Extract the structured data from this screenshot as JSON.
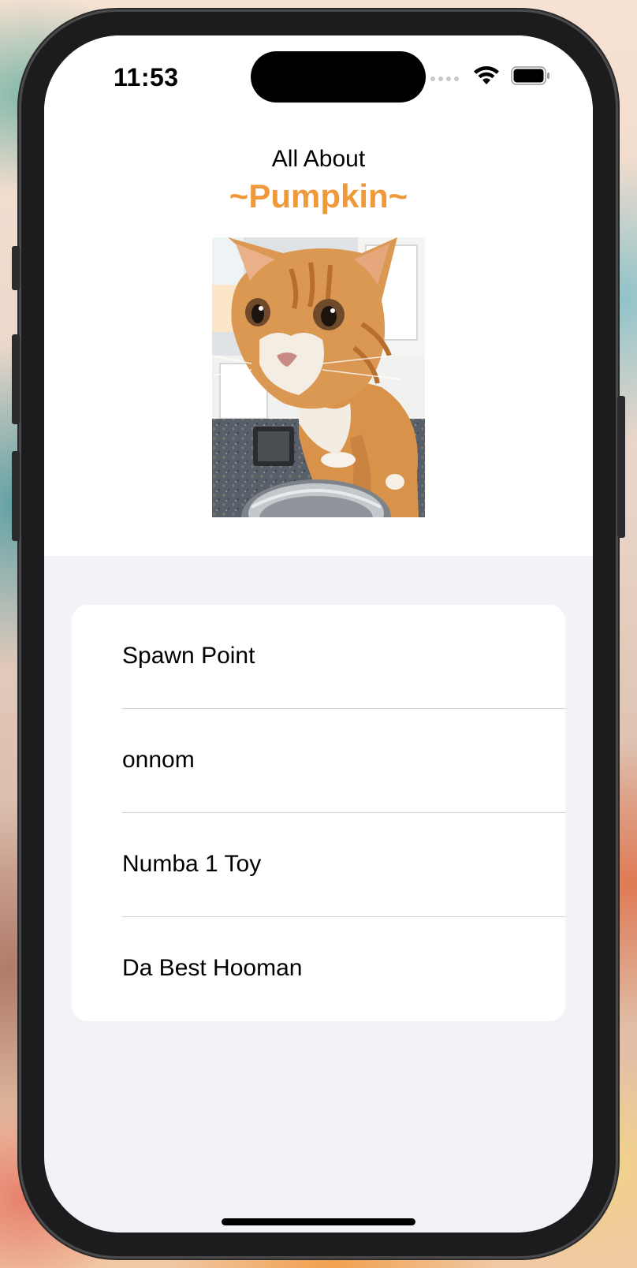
{
  "status_bar": {
    "time": "11:53",
    "icons": [
      "cellular-signal-icon",
      "wifi-icon",
      "battery-icon"
    ]
  },
  "header": {
    "subtitle": "All About",
    "title": "~Pumpkin~",
    "title_color": "#f0993a"
  },
  "photo": {
    "subject": "orange-tabby-cat-photo"
  },
  "list": {
    "items": [
      {
        "label": "Spawn Point"
      },
      {
        "label": "onnom"
      },
      {
        "label": "Numba 1 Toy"
      },
      {
        "label": "Da Best Hooman"
      }
    ]
  },
  "colors": {
    "accent": "#f0993a",
    "grouped_background": "#f2f2f7",
    "card_background": "#ffffff",
    "separator": "#d1d1d6"
  }
}
